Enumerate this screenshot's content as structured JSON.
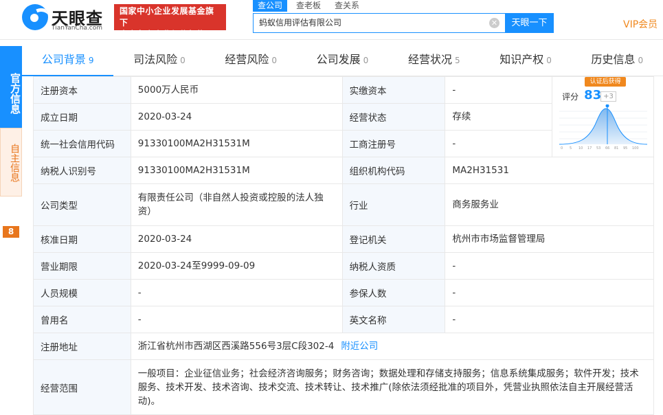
{
  "header": {
    "logo_name": "天眼查",
    "logo_sub": "TianYanCha.com",
    "badge_line1": "国家中小企业发展基金旗下",
    "badge_line2": "官方备案企业征信机构",
    "search_tabs": [
      "查公司",
      "查老板",
      "查关系"
    ],
    "search_value": "蚂蚁信用评估有限公司",
    "search_button": "天眼一下",
    "vip": "VIP会员"
  },
  "side": {
    "official": "官方信息",
    "self": "自主信息",
    "count": "8"
  },
  "nav": [
    {
      "label": "公司背景",
      "count": "9"
    },
    {
      "label": "司法风险",
      "count": "0"
    },
    {
      "label": "经营风险",
      "count": "0"
    },
    {
      "label": "公司发展",
      "count": "0"
    },
    {
      "label": "经营状况",
      "count": "5"
    },
    {
      "label": "知识产权",
      "count": "0"
    },
    {
      "label": "历史信息",
      "count": "0"
    }
  ],
  "score": {
    "cert": "认证后获得",
    "label": "评分",
    "value": "83",
    "plus": "+3",
    "ticks": [
      "0",
      "5",
      "10",
      "17",
      "53",
      "66",
      "81",
      "95",
      "100"
    ]
  },
  "rows": {
    "r1": {
      "l1": "注册资本",
      "v1": "5000万人民币",
      "l2": "实缴资本",
      "v2": "-"
    },
    "r2": {
      "l1": "成立日期",
      "v1": "2020-03-24",
      "l2": "经营状态",
      "v2": "存续"
    },
    "r3": {
      "l1": "统一社会信用代码",
      "v1": "91330100MA2H31531M",
      "l2": "工商注册号",
      "v2": "-"
    },
    "r4": {
      "l1": "纳税人识别号",
      "v1": "91330100MA2H31531M",
      "l2": "组织机构代码",
      "v2": "MA2H31531"
    },
    "r5": {
      "l1": "公司类型",
      "v1": "有限责任公司（非自然人投资或控股的法人独资）",
      "l2": "行业",
      "v2": "商务服务业"
    },
    "r6": {
      "l1": "核准日期",
      "v1": "2020-03-24",
      "l2": "登记机关",
      "v2": "杭州市市场监督管理局"
    },
    "r7": {
      "l1": "营业期限",
      "v1": "2020-03-24至9999-09-09",
      "l2": "纳税人资质",
      "v2": "-"
    },
    "r8": {
      "l1": "人员规模",
      "v1": "-",
      "l2": "参保人数",
      "v2": "-"
    },
    "r9": {
      "l1": "曾用名",
      "v1": "-",
      "l2": "英文名称",
      "v2": "-"
    },
    "r10": {
      "l1": "注册地址",
      "v1": "浙江省杭州市西湖区西溪路556号3层C段302-4",
      "link": "附近公司"
    },
    "r11": {
      "l1": "经营范围",
      "v1": "一般项目：企业征信业务；社会经济咨询服务；财务咨询；数据处理和存储支持服务；信息系统集成服务；软件开发；技术服务、技术开发、技术咨询、技术交流、技术转让、技术推广(除依法须经批准的项目外，凭营业执照依法自主开展经营活动)。"
    }
  }
}
